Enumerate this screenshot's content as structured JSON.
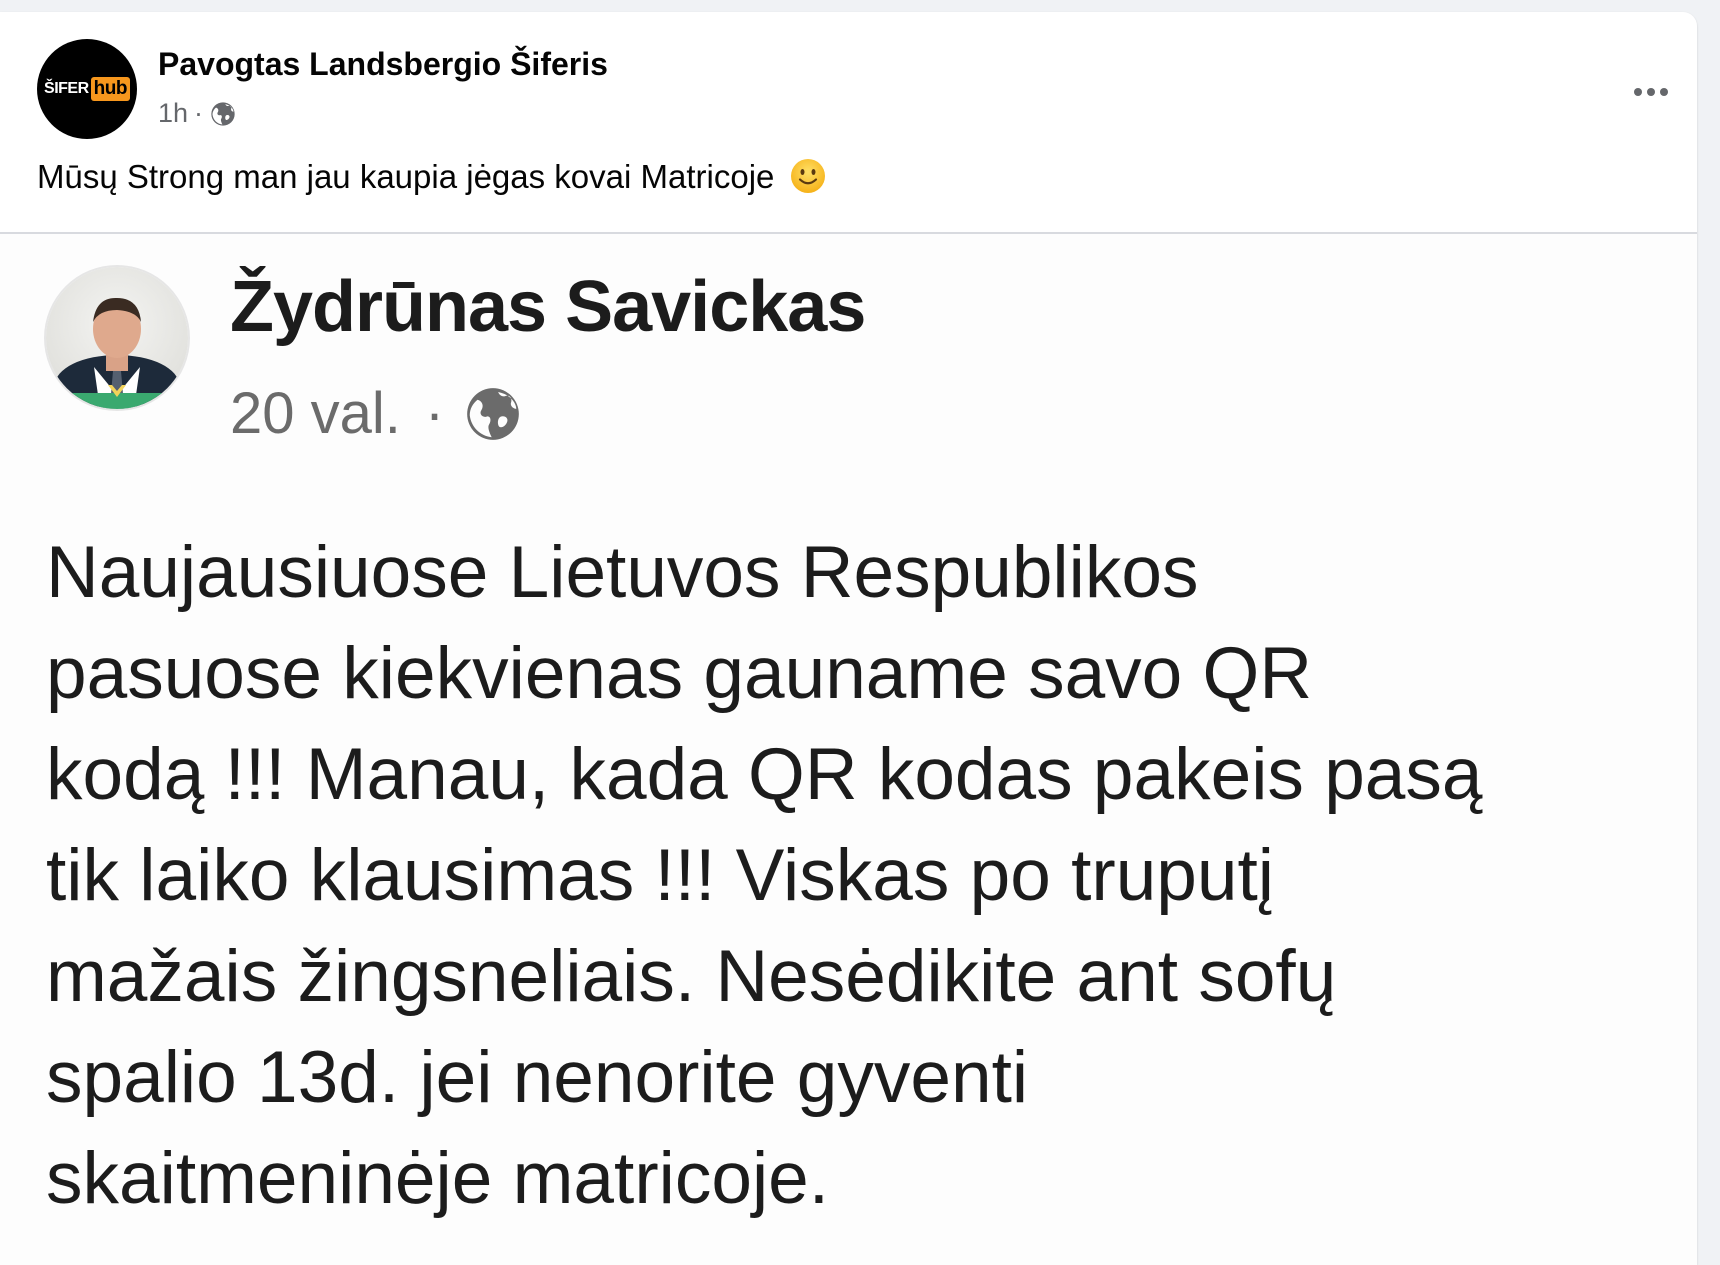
{
  "post": {
    "page_name": "Pavogtas Landsbergio Šiferis",
    "logo_white": "ŠIFER",
    "logo_orange": "hub",
    "time": "1h",
    "separator": "·",
    "privacy_icon": "globe-icon",
    "more_icon": "more-options-icon",
    "text": "Mūsų Strong man jau kaupia jėgas kovai Matricoje",
    "emoji": "slightly-smiling-face-emoji"
  },
  "shared_post": {
    "author": "Žydrūnas Savickas",
    "time": "20 val.",
    "separator": "·",
    "privacy_icon": "globe-icon",
    "body_lines": [
      "Naujausiuose Lietuvos Respublikos",
      "pasuose kiekvienas gauname savo QR",
      "kodą !!! Manau, kada QR kodas pakeis pasą",
      "tik laiko klausimas !!! Viskas po truputį",
      "mažais žingsneliais. Nesėdikite ant sofų",
      "spalio 13d. jei nenorite gyventi",
      "skaitmeninėje matricoje."
    ]
  },
  "colors": {
    "background": "#f0f2f5",
    "card": "#ffffff",
    "secondary_text": "#65676b",
    "logo_accent": "#f7971d"
  }
}
